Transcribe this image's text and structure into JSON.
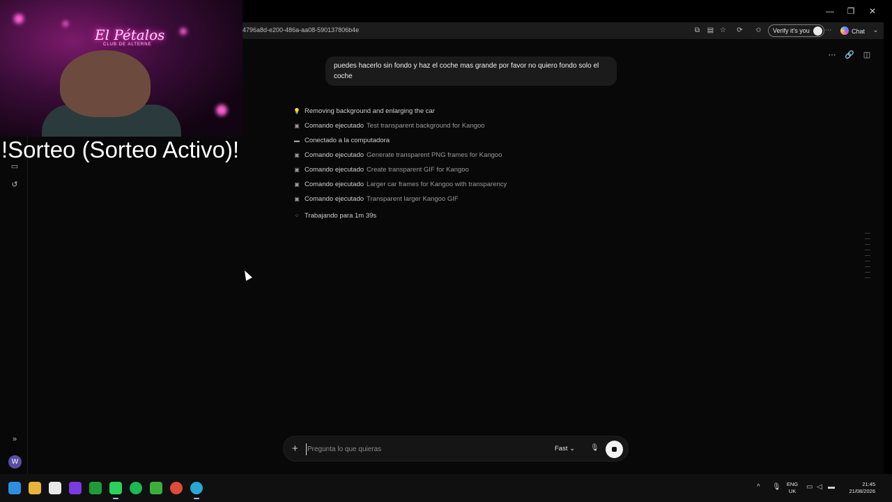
{
  "browser": {
    "url": "4796a8d-e200-486a-aa08-590137806b4e",
    "verify_label": "Verify it's you",
    "chat_label": "Chat"
  },
  "window_controls": {
    "minimize": "—",
    "maximize": "❐",
    "close": "✕"
  },
  "conversation": {
    "user_message": "puedes hacerlo sin fondo y haz el coche mas grande por favor no quiero fondo solo el coche",
    "steps": [
      {
        "icon": "lightbulb-icon",
        "label": "Removing background and enlarging the car",
        "desc": ""
      },
      {
        "icon": "terminal-icon",
        "label": "Comando ejecutado",
        "desc": "Test transparent background for Kangoo"
      },
      {
        "icon": "computer-icon",
        "label": "Conectado a la computadora",
        "desc": ""
      },
      {
        "icon": "terminal-icon",
        "label": "Comando ejecutado",
        "desc": "Generate transparent PNG frames for Kangoo"
      },
      {
        "icon": "terminal-icon",
        "label": "Comando ejecutado",
        "desc": "Create transparent GIF for Kangoo"
      },
      {
        "icon": "terminal-icon",
        "label": "Comando ejecutado",
        "desc": "Larger car frames for Kangoo with transparency"
      },
      {
        "icon": "terminal-icon",
        "label": "Comando ejecutado",
        "desc": "Transparent larger Kangoo GIF"
      }
    ],
    "working_status": "Trabajando para 1m 39s"
  },
  "composer": {
    "placeholder": "Pregunta lo que quieras",
    "mode_label": "Fast"
  },
  "sidebar": {
    "avatar_initial": "W"
  },
  "overlay": {
    "neon_sign": "El Pétalos",
    "neon_sub": "CLUB DE ALTERNE",
    "banner_text": "!Sorteo (Sorteo Activo)!"
  },
  "taskbar": {
    "language": "ENG",
    "region": "UK",
    "time": "21:45",
    "date": "21/08/2026"
  }
}
